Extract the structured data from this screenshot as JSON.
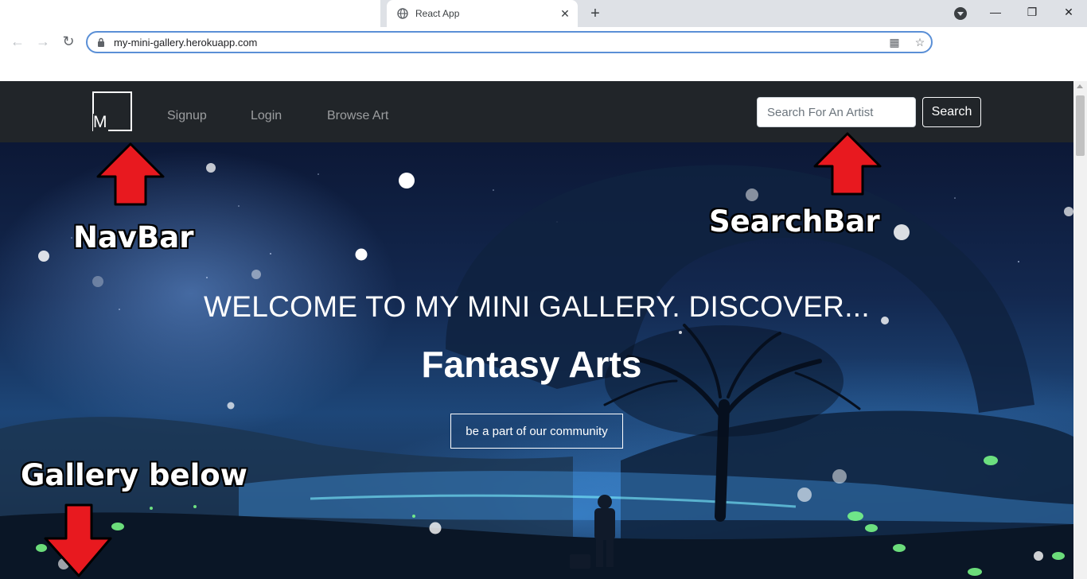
{
  "browser": {
    "tab_title": "React App",
    "tab_close": "✕",
    "new_tab": "+",
    "url": "my-mini-gallery.herokuapp.com",
    "nav_icons": [
      "back-icon",
      "forward-icon",
      "reload-icon"
    ],
    "omnibox_icons": [
      "qr-code-icon",
      "star-icon"
    ],
    "window_controls": [
      "minimize-icon",
      "restore-icon",
      "close-icon"
    ]
  },
  "navbar": {
    "logo_text": "M",
    "links": [
      "Signup",
      "Login",
      "Browse Art"
    ],
    "search_placeholder": "Search For An Artist",
    "search_button": "Search"
  },
  "hero": {
    "welcome": "WELCOME TO MY MINI GALLERY. DISCOVER...",
    "headline": "Fantasy Arts",
    "cta": "be a part of our community"
  },
  "annotations": {
    "navbar_label": "NavBar",
    "searchbar_label": "SearchBar",
    "gallery_label": "Gallery below",
    "arrow_color": "#e8191f"
  }
}
